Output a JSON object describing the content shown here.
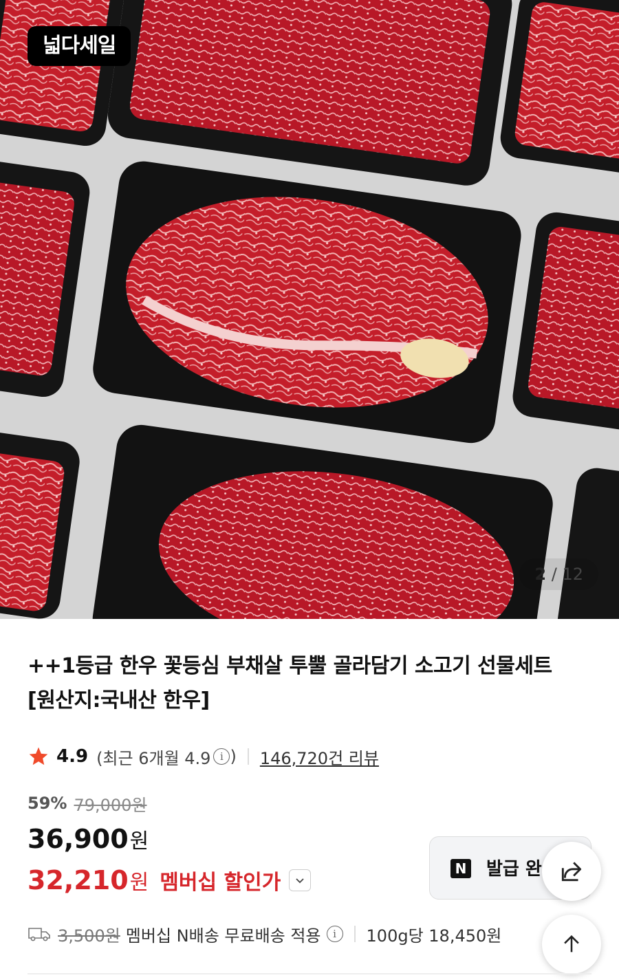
{
  "hero": {
    "badge": "넓다세일",
    "counter": {
      "current": "2",
      "separator": "/",
      "total": "12"
    }
  },
  "product": {
    "title": "++1등급 한우 꽃등심 부채살 투뿔 골라담기 소고기 선물세트 [원산지:국내산 한우]",
    "rating": "4.9",
    "rating_recent": "(최근 6개월 4.9",
    "rating_recent_close": ")",
    "review_count": "146,720건 리뷰"
  },
  "pricing": {
    "discount_pct": "59%",
    "original_price": "79,000원",
    "price": "36,900",
    "price_unit": "원",
    "member_price": "32,210",
    "member_price_unit": "원",
    "member_label": "멤버십 할인가"
  },
  "coupon": {
    "logo": "N",
    "label": "발급 완"
  },
  "shipping": {
    "original_fee": "3,500원",
    "text": "멤버십 N배송 무료배송 적용",
    "unit_price": "100g당 18,450원"
  },
  "colors": {
    "accent_red": "#d6262b",
    "star": "#f04a2a",
    "meat": "#c8202c",
    "tray": "#141414"
  },
  "icons": [
    "star-icon",
    "info-icon",
    "chevron-down-icon",
    "share-icon",
    "arrow-up-icon",
    "truck-icon"
  ]
}
